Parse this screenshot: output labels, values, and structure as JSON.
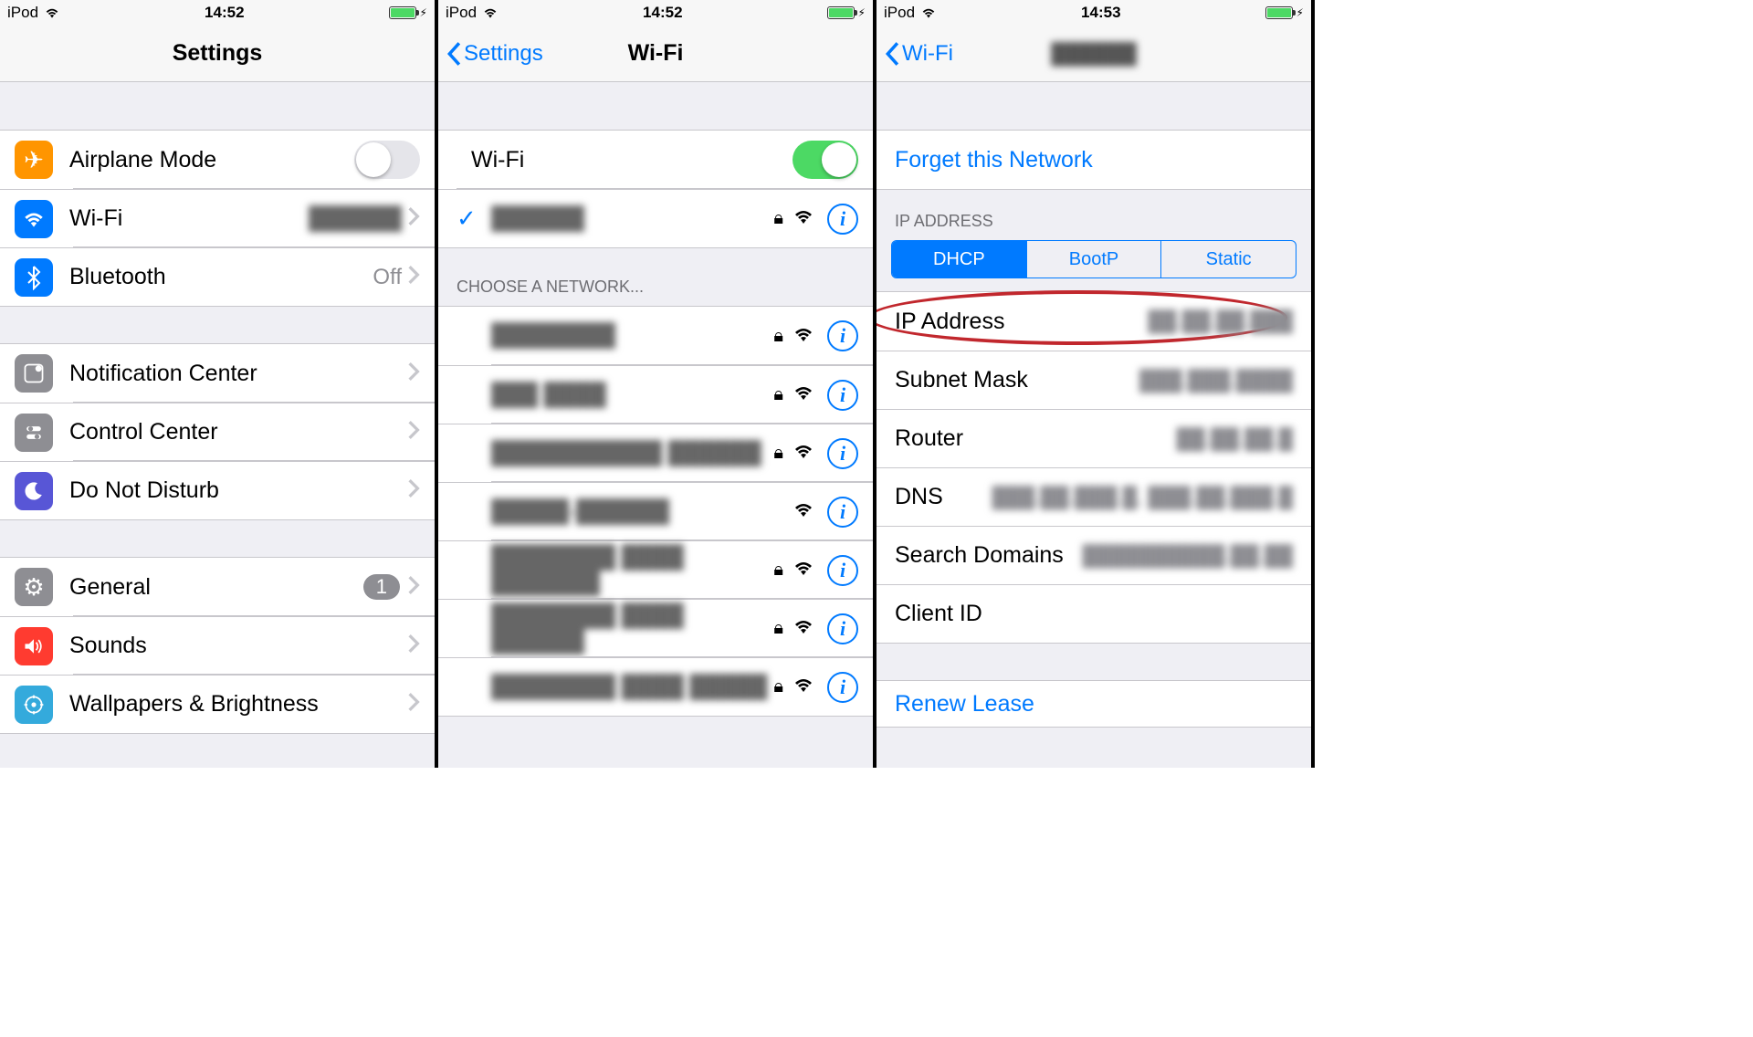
{
  "statusbar": {
    "device": "iPod",
    "time1": "14:52",
    "time2": "14:52",
    "time3": "14:53"
  },
  "screen1": {
    "title": "Settings",
    "rows": {
      "airplane": "Airplane Mode",
      "wifi": "Wi-Fi",
      "wifi_value": "██████",
      "bluetooth": "Bluetooth",
      "bluetooth_value": "Off",
      "notif": "Notification Center",
      "control": "Control Center",
      "dnd": "Do Not Disturb",
      "general": "General",
      "general_badge": "1",
      "sounds": "Sounds",
      "wallpapers": "Wallpapers & Brightness"
    }
  },
  "screen2": {
    "back": "Settings",
    "title": "Wi-Fi",
    "wifi_label": "Wi-Fi",
    "connected": "██████",
    "choose_header": "CHOOSE A NETWORK...",
    "networks": [
      {
        "name": "████████",
        "locked": true
      },
      {
        "name": "███ ████",
        "locked": true
      },
      {
        "name": "███████████ ██████",
        "locked": true
      },
      {
        "name": "█████-██████",
        "locked": false
      },
      {
        "name": "████████ ████ ███████",
        "locked": true
      },
      {
        "name": "████████ ████ ██████",
        "locked": true
      },
      {
        "name": "████████ ████ █████",
        "locked": true
      }
    ]
  },
  "screen3": {
    "back": "Wi-Fi",
    "title": "██████",
    "forget": "Forget this Network",
    "ip_header": "IP ADDRESS",
    "tabs": {
      "dhcp": "DHCP",
      "bootp": "BootP",
      "static": "Static"
    },
    "rows": {
      "ip": "IP Address",
      "ip_v": "██.██.██.███",
      "subnet": "Subnet Mask",
      "subnet_v": "███.███.████",
      "router": "Router",
      "router_v": "██.██.██.█",
      "dns": "DNS",
      "dns_v": "███.██.███.█, ███.██.███.█",
      "search": "Search Domains",
      "search_v": "██████████.██.██",
      "client": "Client ID",
      "client_v": ""
    },
    "renew": "Renew Lease"
  }
}
